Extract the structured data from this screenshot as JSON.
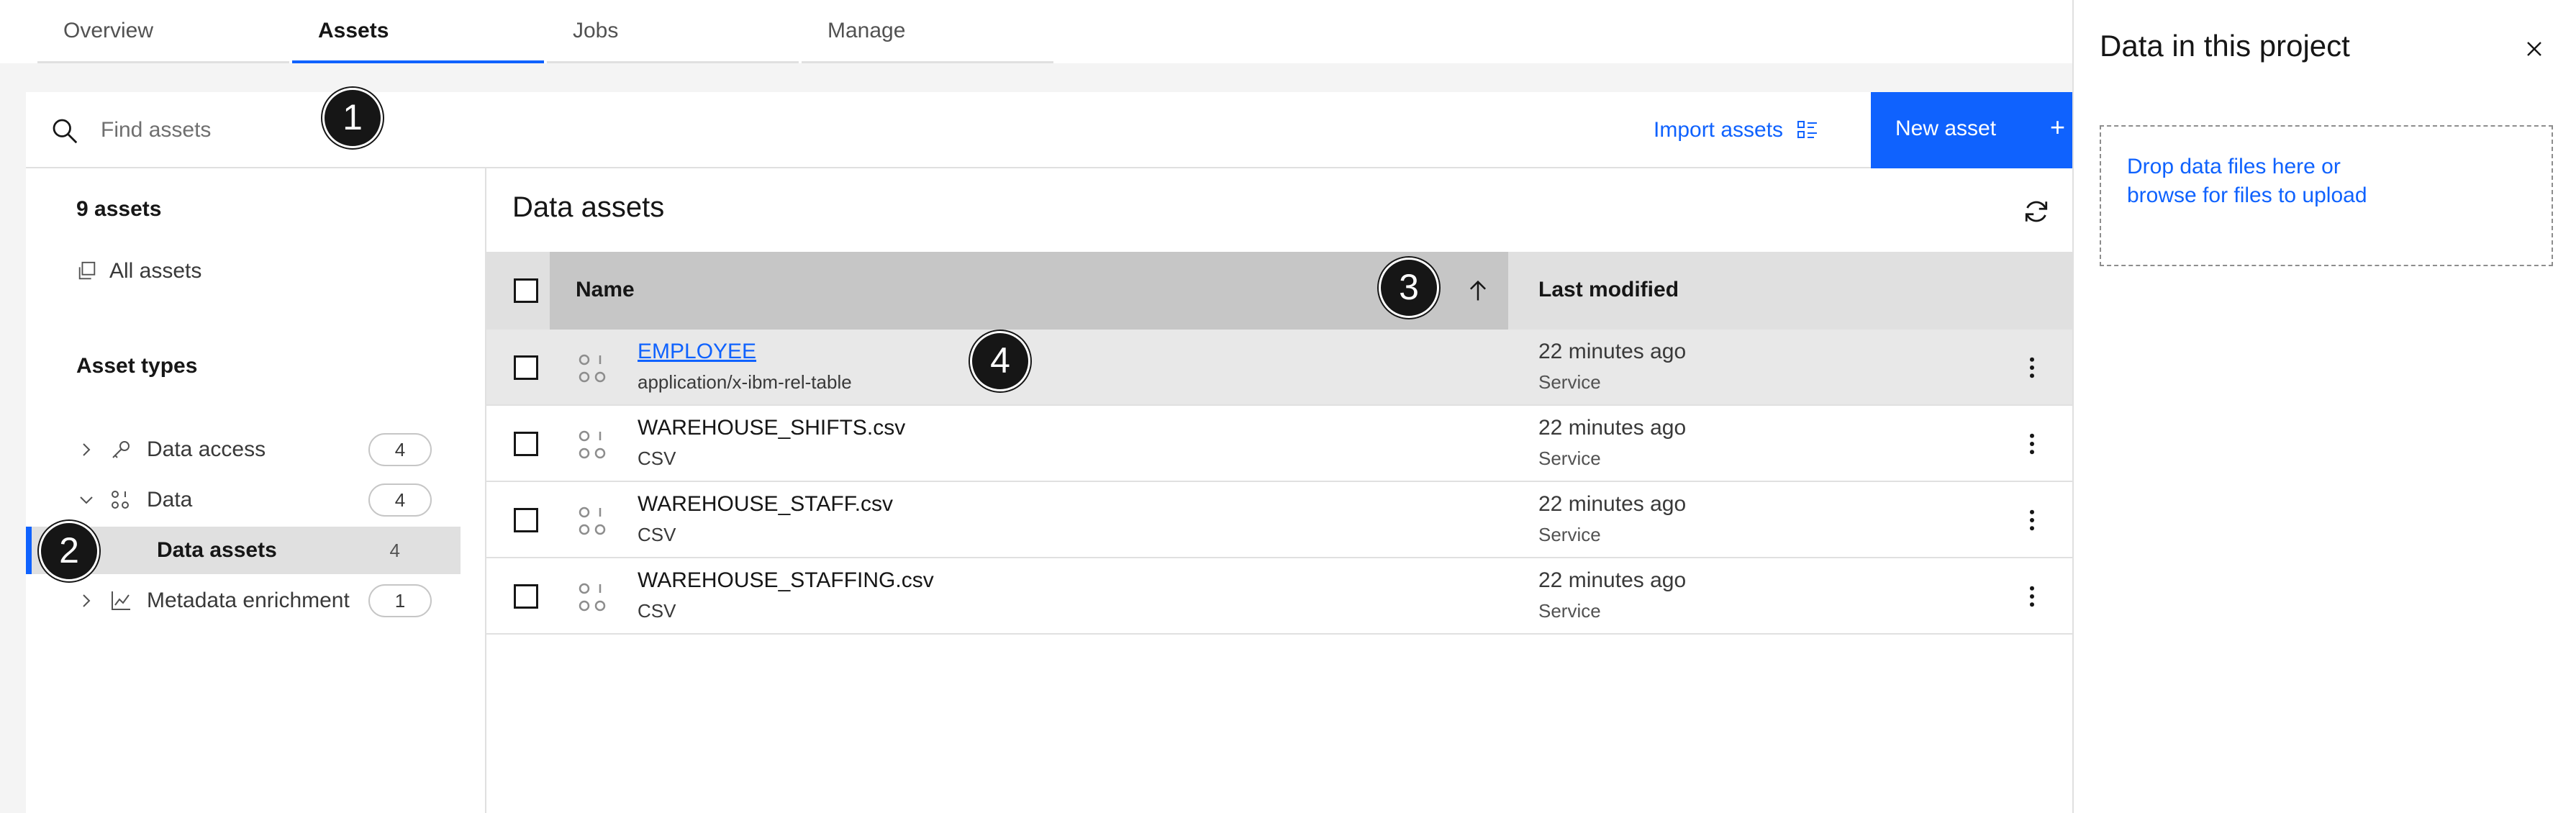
{
  "tabs": [
    {
      "label": "Overview"
    },
    {
      "label": "Assets"
    },
    {
      "label": "Jobs"
    },
    {
      "label": "Manage"
    }
  ],
  "toolbar": {
    "search_placeholder": "Find assets",
    "import_label": "Import assets",
    "new_asset_label": "New asset",
    "new_asset_icon": "+"
  },
  "sidebar": {
    "count_label": "9 assets",
    "all_assets_label": "All assets",
    "asset_types_heading": "Asset types",
    "items": [
      {
        "label": "Data access",
        "count": "4",
        "icon": "key-icon",
        "state": "collapsed"
      },
      {
        "label": "Data",
        "count": "4",
        "icon": "data-icon",
        "state": "expanded"
      },
      {
        "label": "Data assets",
        "count": "4",
        "state": "selected"
      },
      {
        "label": "Metadata enrichment",
        "count": "1",
        "icon": "chart-icon",
        "state": "collapsed"
      }
    ]
  },
  "main": {
    "title": "Data assets",
    "columns": {
      "name": "Name",
      "modified": "Last modified"
    },
    "rows": [
      {
        "name": "EMPLOYEE",
        "type": "application/x-ibm-rel-table",
        "modified": "22 minutes ago",
        "by": "Service"
      },
      {
        "name": "WAREHOUSE_SHIFTS.csv",
        "type": "CSV",
        "modified": "22 minutes ago",
        "by": "Service"
      },
      {
        "name": "WAREHOUSE_STAFF.csv",
        "type": "CSV",
        "modified": "22 minutes ago",
        "by": "Service"
      },
      {
        "name": "WAREHOUSE_STAFFING.csv",
        "type": "CSV",
        "modified": "22 minutes ago",
        "by": "Service"
      }
    ]
  },
  "right_panel": {
    "title": "Data in this project",
    "dropzone_text": "Drop data files here or browse for files to upload"
  },
  "callouts": [
    "1",
    "2",
    "3",
    "4"
  ],
  "colors": {
    "accent": "#0f62fe",
    "callout": "#161616"
  }
}
